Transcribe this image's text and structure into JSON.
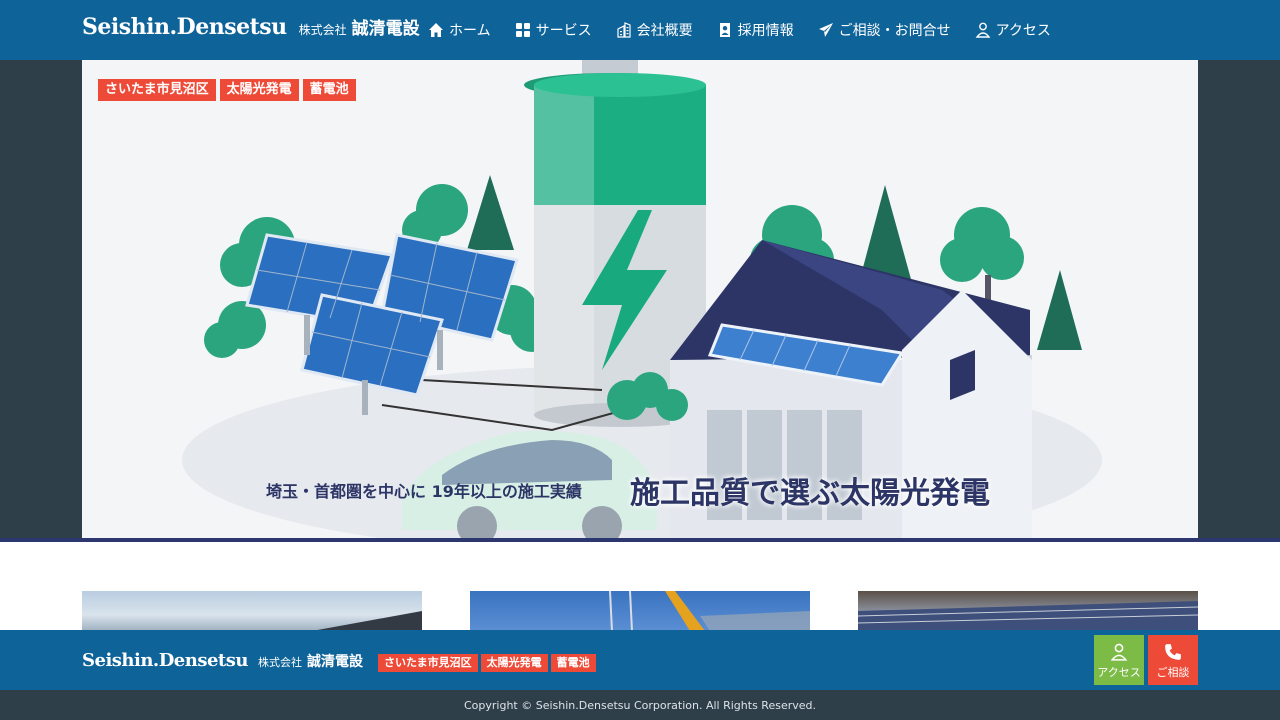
{
  "header": {
    "logo": "Seishin.Densetsu",
    "company_prefix": "株式会社",
    "company_name": "誠清電設",
    "nav": [
      {
        "label": "ホーム",
        "icon": "home-icon"
      },
      {
        "label": "サービス",
        "icon": "grid-icon"
      },
      {
        "label": "会社概要",
        "icon": "building-icon"
      },
      {
        "label": "採用情報",
        "icon": "id-badge-icon"
      },
      {
        "label": "ご相談・お問合せ",
        "icon": "paper-plane-icon"
      },
      {
        "label": "アクセス",
        "icon": "person-pin-icon"
      }
    ]
  },
  "hero": {
    "tags": [
      "さいたま市見沼区",
      "太陽光発電",
      "蓄電池"
    ],
    "subtitle": "埼玉・首都圏を中心に 19年以上の施工実績",
    "title": "施工品質で選ぶ太陽光発電"
  },
  "footer": {
    "logo": "Seishin.Densetsu",
    "company_prefix": "株式会社",
    "company_name": "誠清電設",
    "tags": [
      "さいたま市見沼区",
      "太陽光発電",
      "蓄電池"
    ],
    "access_label": "アクセス",
    "contact_label": "ご相談",
    "copyright": "Copyright © Seishin.Densetsu Corporation. All Rights Reserved."
  },
  "colors": {
    "header_blue": "#0e6399",
    "dark_band": "#2f3f4a",
    "tag_red": "#ee4a38",
    "access_green": "#7dbb47",
    "title_navy": "#2c3566"
  }
}
